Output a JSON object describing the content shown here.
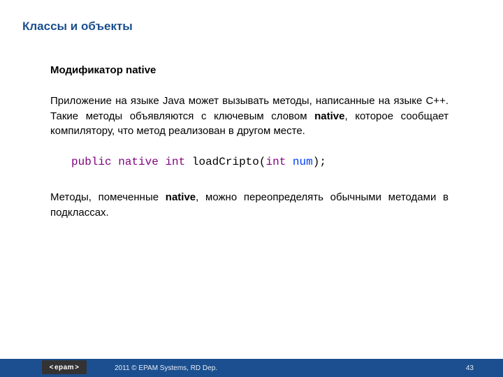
{
  "title": "Классы и объекты",
  "subheading": "Модификатор native",
  "para1": {
    "a": "Приложение на языке Java может вызывать методы, написанные на языке С++. Такие методы объявляются с ключевым словом ",
    "kw": "native",
    "b": ", которое сообщает компилятору, что метод реализован в другом месте."
  },
  "code": {
    "kw1": "public",
    "kw2": "native",
    "kw3": "int",
    "fn": "loadCripto",
    "lp": "(",
    "ptype": "int",
    "pname": "num",
    "rp": ")",
    "semi": ";"
  },
  "para2": {
    "a": "Методы, помеченные ",
    "kw": "native",
    "b": ", можно переопределять обычными методами в подклассах."
  },
  "footer": {
    "logo": "epam",
    "text": "2011 © EPAM Systems, RD Dep.",
    "page": "43"
  }
}
